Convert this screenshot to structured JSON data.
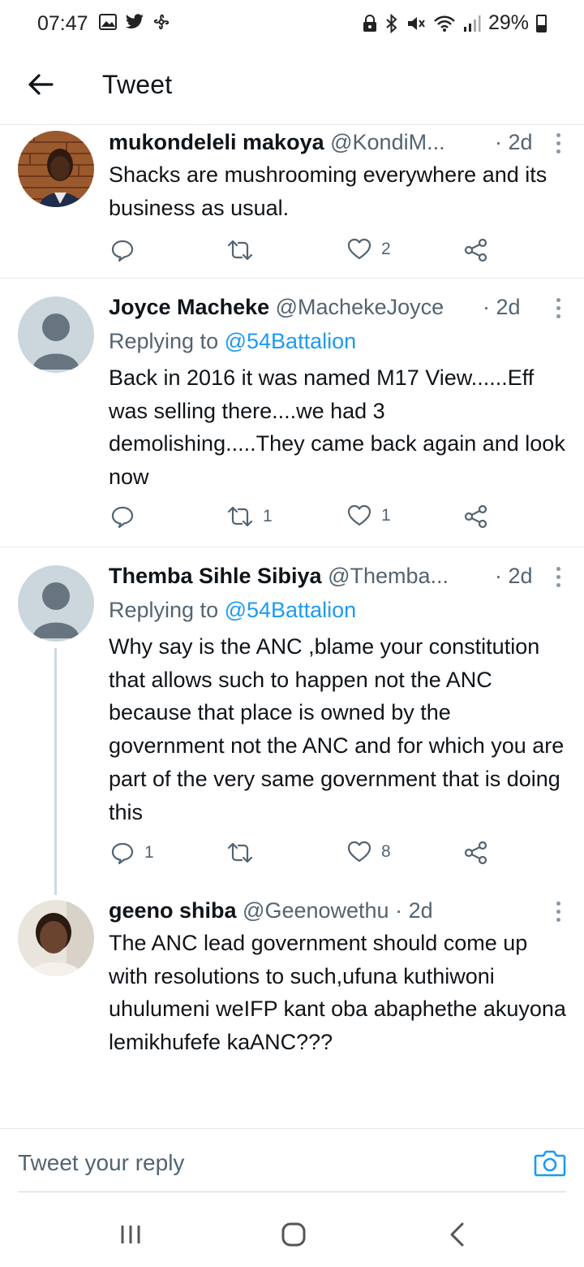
{
  "status_bar": {
    "time": "07:47",
    "battery": "29%",
    "left_icons": [
      "gallery-icon",
      "twitter-bird-icon",
      "fan-icon"
    ],
    "right_icons": [
      "lock-icon",
      "bluetooth-icon",
      "mute-icon",
      "wifi-icon",
      "signal-icon",
      "battery-icon"
    ]
  },
  "header": {
    "title": "Tweet"
  },
  "tweets": [
    {
      "name": "mukondeleli makoya",
      "handle": "@KondiM...",
      "time": "· 2d",
      "replying_prefix": "",
      "replying_to": "",
      "text": "Shacks are mushrooming everywhere and its business as usual.",
      "replies": "",
      "retweets": "",
      "likes": "2"
    },
    {
      "name": "Joyce Macheke",
      "handle": "@MachekeJoyce",
      "time": "· 2d",
      "replying_prefix": "Replying to",
      "replying_to": "@54Battalion",
      "text": "Back in 2016 it was named M17 View......Eff was selling there....we had 3 demolishing.....They came back again and look now",
      "replies": "",
      "retweets": "1",
      "likes": "1"
    },
    {
      "name": "Themba Sihle Sibiya",
      "handle": "@Themba...",
      "time": "· 2d",
      "replying_prefix": "Replying to",
      "replying_to": "@54Battalion",
      "text": "Why say is the ANC ,blame your constitution that allows such to happen not the ANC because that place is owned by the government not the ANC and for which you are part of the very same government that is doing this",
      "replies": "1",
      "retweets": "",
      "likes": "8"
    },
    {
      "name": "geeno shiba",
      "handle": "@Geenowethu",
      "time": "· 2d",
      "text": "The ANC lead government should come up with resolutions to such,ufuna kuthiwoni uhulumeni weIFP kant oba abaphethe akuyona lemikhufefe kaANC???"
    }
  ],
  "reply_bar": {
    "placeholder": "Tweet your reply"
  },
  "colors": {
    "accent": "#1d9bf0",
    "text": "#0f1419",
    "muted": "#536471",
    "divider": "#e6e9ec"
  }
}
